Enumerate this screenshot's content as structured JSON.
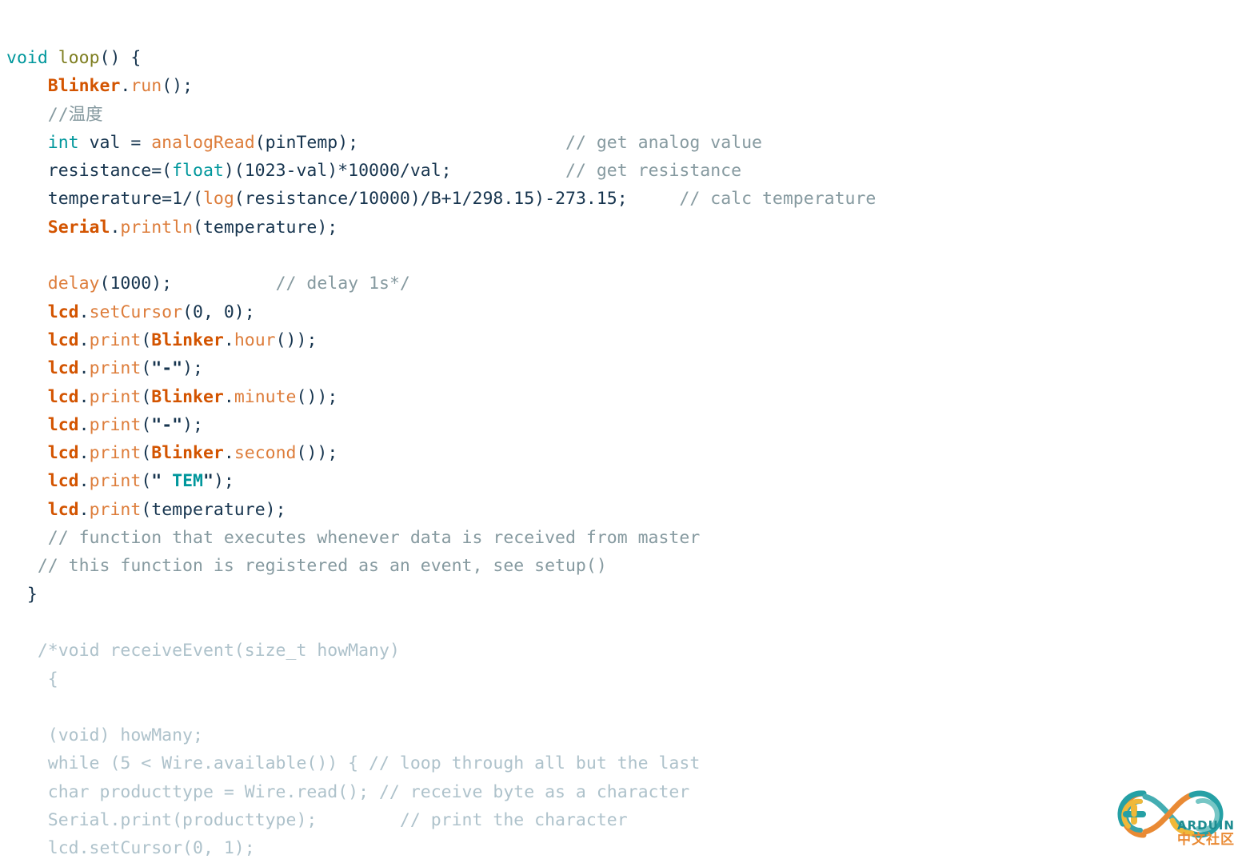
{
  "document": {
    "kind": "arduino-sketch-code-listing",
    "background_color": "#ffffff",
    "language": "C++ / Arduino"
  },
  "theme": {
    "plain": "#17354f",
    "keyword_teal": "#00979c",
    "function_definition": "#7e7e20",
    "object_orange_bold": "#d35400",
    "method_orange": "#dd7d3b",
    "line_comment_gray": "#869aa0",
    "block_comment_gray": "#aec2cb",
    "string": "#17354f"
  },
  "code": {
    "lines": [
      {
        "index": 0,
        "text": "void loop() {",
        "tokens": [
          {
            "t": "void",
            "c": "t-keyword"
          },
          {
            "t": " ",
            "c": "t-plain"
          },
          {
            "t": "loop",
            "c": "t-func-def"
          },
          {
            "t": "() {",
            "c": "t-plain"
          }
        ]
      },
      {
        "index": 1,
        "text": "    Blinker.run();",
        "tokens": [
          {
            "t": "    ",
            "c": "t-plain"
          },
          {
            "t": "Blinker",
            "c": "t-object"
          },
          {
            "t": ".",
            "c": "t-plain"
          },
          {
            "t": "run",
            "c": "t-method"
          },
          {
            "t": "();",
            "c": "t-plain"
          }
        ]
      },
      {
        "index": 2,
        "text": "    //温度",
        "tokens": [
          {
            "t": "    ",
            "c": "t-plain"
          },
          {
            "t": "//温度",
            "c": "t-comment"
          }
        ]
      },
      {
        "index": 3,
        "text": "    int val = analogRead(pinTemp);                    // get analog value",
        "tokens": [
          {
            "t": "    ",
            "c": "t-plain"
          },
          {
            "t": "int",
            "c": "t-keyword"
          },
          {
            "t": " val = ",
            "c": "t-plain"
          },
          {
            "t": "analogRead",
            "c": "t-method"
          },
          {
            "t": "(pinTemp);",
            "c": "t-plain"
          },
          {
            "t": "                    ",
            "c": "t-plain"
          },
          {
            "t": "// get analog value",
            "c": "t-comment"
          }
        ]
      },
      {
        "index": 4,
        "text": "    resistance=(float)(1023-val)*10000/val;           // get resistance",
        "tokens": [
          {
            "t": "    resistance=(",
            "c": "t-plain"
          },
          {
            "t": "float",
            "c": "t-keyword"
          },
          {
            "t": ")(1023-val)*10000/val;",
            "c": "t-plain"
          },
          {
            "t": "           ",
            "c": "t-plain"
          },
          {
            "t": "// get resistance",
            "c": "t-comment"
          }
        ]
      },
      {
        "index": 5,
        "text": "    temperature=1/(log(resistance/10000)/B+1/298.15)-273.15;     // calc temperature",
        "tokens": [
          {
            "t": "    temperature=1/(",
            "c": "t-plain"
          },
          {
            "t": "log",
            "c": "t-method"
          },
          {
            "t": "(resistance/10000)/B+1/298.15)-273.15;",
            "c": "t-plain"
          },
          {
            "t": "     ",
            "c": "t-plain"
          },
          {
            "t": "// calc temperature",
            "c": "t-comment"
          }
        ]
      },
      {
        "index": 6,
        "text": "    Serial.println(temperature);",
        "tokens": [
          {
            "t": "    ",
            "c": "t-plain"
          },
          {
            "t": "Serial",
            "c": "t-object"
          },
          {
            "t": ".",
            "c": "t-plain"
          },
          {
            "t": "println",
            "c": "t-method"
          },
          {
            "t": "(temperature);",
            "c": "t-plain"
          }
        ]
      },
      {
        "index": 7,
        "text": "",
        "tokens": []
      },
      {
        "index": 8,
        "text": "    delay(1000);          // delay 1s*/",
        "tokens": [
          {
            "t": "    ",
            "c": "t-plain"
          },
          {
            "t": "delay",
            "c": "t-method"
          },
          {
            "t": "(1000);",
            "c": "t-plain"
          },
          {
            "t": "          ",
            "c": "t-plain"
          },
          {
            "t": "// delay 1s*/",
            "c": "t-comment"
          }
        ]
      },
      {
        "index": 9,
        "text": "    lcd.setCursor(0, 0);",
        "tokens": [
          {
            "t": "    ",
            "c": "t-plain"
          },
          {
            "t": "lcd",
            "c": "t-object"
          },
          {
            "t": ".",
            "c": "t-plain"
          },
          {
            "t": "setCursor",
            "c": "t-method"
          },
          {
            "t": "(0, 0);",
            "c": "t-plain"
          }
        ]
      },
      {
        "index": 10,
        "text": "    lcd.print(Blinker.hour());",
        "tokens": [
          {
            "t": "    ",
            "c": "t-plain"
          },
          {
            "t": "lcd",
            "c": "t-object"
          },
          {
            "t": ".",
            "c": "t-plain"
          },
          {
            "t": "print",
            "c": "t-method"
          },
          {
            "t": "(",
            "c": "t-plain"
          },
          {
            "t": "Blinker",
            "c": "t-object"
          },
          {
            "t": ".",
            "c": "t-plain"
          },
          {
            "t": "hour",
            "c": "t-method"
          },
          {
            "t": "());",
            "c": "t-plain"
          }
        ]
      },
      {
        "index": 11,
        "text": "    lcd.print(\"-\");",
        "tokens": [
          {
            "t": "    ",
            "c": "t-plain"
          },
          {
            "t": "lcd",
            "c": "t-object"
          },
          {
            "t": ".",
            "c": "t-plain"
          },
          {
            "t": "print",
            "c": "t-method"
          },
          {
            "t": "(",
            "c": "t-plain"
          },
          {
            "t": "\"-\"",
            "c": "t-string"
          },
          {
            "t": ");",
            "c": "t-plain"
          }
        ]
      },
      {
        "index": 12,
        "text": "    lcd.print(Blinker.minute());",
        "tokens": [
          {
            "t": "    ",
            "c": "t-plain"
          },
          {
            "t": "lcd",
            "c": "t-object"
          },
          {
            "t": ".",
            "c": "t-plain"
          },
          {
            "t": "print",
            "c": "t-method"
          },
          {
            "t": "(",
            "c": "t-plain"
          },
          {
            "t": "Blinker",
            "c": "t-object"
          },
          {
            "t": ".",
            "c": "t-plain"
          },
          {
            "t": "minute",
            "c": "t-method"
          },
          {
            "t": "());",
            "c": "t-plain"
          }
        ]
      },
      {
        "index": 13,
        "text": "    lcd.print(\"-\");",
        "tokens": [
          {
            "t": "    ",
            "c": "t-plain"
          },
          {
            "t": "lcd",
            "c": "t-object"
          },
          {
            "t": ".",
            "c": "t-plain"
          },
          {
            "t": "print",
            "c": "t-method"
          },
          {
            "t": "(",
            "c": "t-plain"
          },
          {
            "t": "\"-\"",
            "c": "t-string"
          },
          {
            "t": ");",
            "c": "t-plain"
          }
        ]
      },
      {
        "index": 14,
        "text": "    lcd.print(Blinker.second());",
        "tokens": [
          {
            "t": "    ",
            "c": "t-plain"
          },
          {
            "t": "lcd",
            "c": "t-object"
          },
          {
            "t": ".",
            "c": "t-plain"
          },
          {
            "t": "print",
            "c": "t-method"
          },
          {
            "t": "(",
            "c": "t-plain"
          },
          {
            "t": "Blinker",
            "c": "t-object"
          },
          {
            "t": ".",
            "c": "t-plain"
          },
          {
            "t": "second",
            "c": "t-method"
          },
          {
            "t": "());",
            "c": "t-plain"
          }
        ]
      },
      {
        "index": 15,
        "text": "    lcd.print(\" TEM\");",
        "tokens": [
          {
            "t": "    ",
            "c": "t-plain"
          },
          {
            "t": "lcd",
            "c": "t-object"
          },
          {
            "t": ".",
            "c": "t-plain"
          },
          {
            "t": "print",
            "c": "t-method"
          },
          {
            "t": "(",
            "c": "t-plain"
          },
          {
            "t": "\" ",
            "c": "t-string"
          },
          {
            "t": "TEM",
            "c": "t-string-inner"
          },
          {
            "t": "\"",
            "c": "t-string"
          },
          {
            "t": ");",
            "c": "t-plain"
          }
        ]
      },
      {
        "index": 16,
        "text": "    lcd.print(temperature);",
        "tokens": [
          {
            "t": "    ",
            "c": "t-plain"
          },
          {
            "t": "lcd",
            "c": "t-object"
          },
          {
            "t": ".",
            "c": "t-plain"
          },
          {
            "t": "print",
            "c": "t-method"
          },
          {
            "t": "(temperature);",
            "c": "t-plain"
          }
        ]
      },
      {
        "index": 17,
        "text": "    // function that executes whenever data is received from master",
        "tokens": [
          {
            "t": "    ",
            "c": "t-plain"
          },
          {
            "t": "// function that executes whenever data is received from master",
            "c": "t-comment"
          }
        ]
      },
      {
        "index": 18,
        "text": "   // this function is registered as an event, see setup()",
        "tokens": [
          {
            "t": "   ",
            "c": "t-plain"
          },
          {
            "t": "// this function is registered as an event, see setup()",
            "c": "t-comment"
          }
        ]
      },
      {
        "index": 19,
        "text": "  }",
        "tokens": [
          {
            "t": "  }",
            "c": "t-plain"
          }
        ]
      },
      {
        "index": 20,
        "text": "",
        "tokens": []
      },
      {
        "index": 21,
        "text": "   /*void receiveEvent(size_t howMany)",
        "tokens": [
          {
            "t": "   ",
            "c": "t-plain"
          },
          {
            "t": "/*void receiveEvent(size_t howMany)",
            "c": "t-blockcomment"
          }
        ]
      },
      {
        "index": 22,
        "text": "    {",
        "tokens": [
          {
            "t": "    ",
            "c": "t-plain"
          },
          {
            "t": "{",
            "c": "t-blockcomment"
          }
        ]
      },
      {
        "index": 23,
        "text": "",
        "tokens": []
      },
      {
        "index": 24,
        "text": "    (void) howMany;",
        "tokens": [
          {
            "t": "    ",
            "c": "t-plain"
          },
          {
            "t": "(void) howMany;",
            "c": "t-blockcomment"
          }
        ]
      },
      {
        "index": 25,
        "text": "    while (5 < Wire.available()) { // loop through all but the last",
        "tokens": [
          {
            "t": "    ",
            "c": "t-plain"
          },
          {
            "t": "while (5 < Wire.available()) { // loop through all but the last",
            "c": "t-blockcomment"
          }
        ]
      },
      {
        "index": 26,
        "text": "    char producttype = Wire.read(); // receive byte as a character",
        "tokens": [
          {
            "t": "    ",
            "c": "t-plain"
          },
          {
            "t": "char producttype = Wire.read(); // receive byte as a character",
            "c": "t-blockcomment"
          }
        ]
      },
      {
        "index": 27,
        "text": "    Serial.print(producttype);        // print the character",
        "tokens": [
          {
            "t": "    ",
            "c": "t-plain"
          },
          {
            "t": "Serial.print(producttype);        // print the character",
            "c": "t-blockcomment"
          }
        ]
      },
      {
        "index": 28,
        "text": "    lcd.setCursor(0, 1);",
        "tokens": [
          {
            "t": "    ",
            "c": "t-plain"
          },
          {
            "t": "lcd.setCursor(0, 1);",
            "c": "t-blockcomment"
          }
        ]
      }
    ]
  },
  "watermark": {
    "brand": "ARDUINO",
    "community": "中文社区",
    "logo_icon": "arduino-infinity-logo",
    "teal": "#0b8f95",
    "orange": "#e8842a",
    "yellow": "#f0b52e"
  }
}
